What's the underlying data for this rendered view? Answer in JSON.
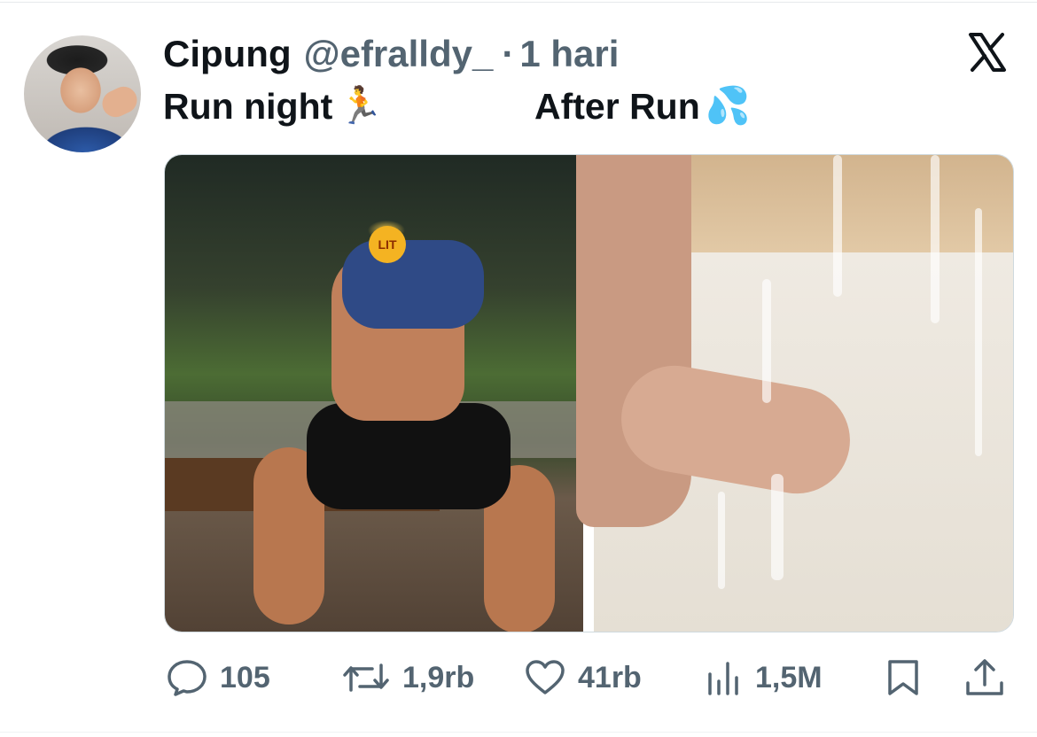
{
  "tweet": {
    "author_name": "Cipung",
    "handle": "@efralldy_",
    "separator": "·",
    "time": "1 hari",
    "caption_left": "Run night",
    "caption_left_emoji": "🏃",
    "caption_right": "After Run",
    "caption_right_emoji": "💦",
    "sticker_label": "LIT"
  },
  "actions": {
    "replies": "105",
    "reposts": "1,9rb",
    "likes": "41rb",
    "views": "1,5M"
  },
  "icons": {
    "brand": "x-logo-icon",
    "reply": "reply-icon",
    "repost": "repost-icon",
    "like": "heart-icon",
    "views": "views-bars-icon",
    "bookmark": "bookmark-icon",
    "share": "share-icon"
  },
  "colors": {
    "text_primary": "#0f1419",
    "text_secondary": "#536471",
    "border": "#cfd9de"
  }
}
